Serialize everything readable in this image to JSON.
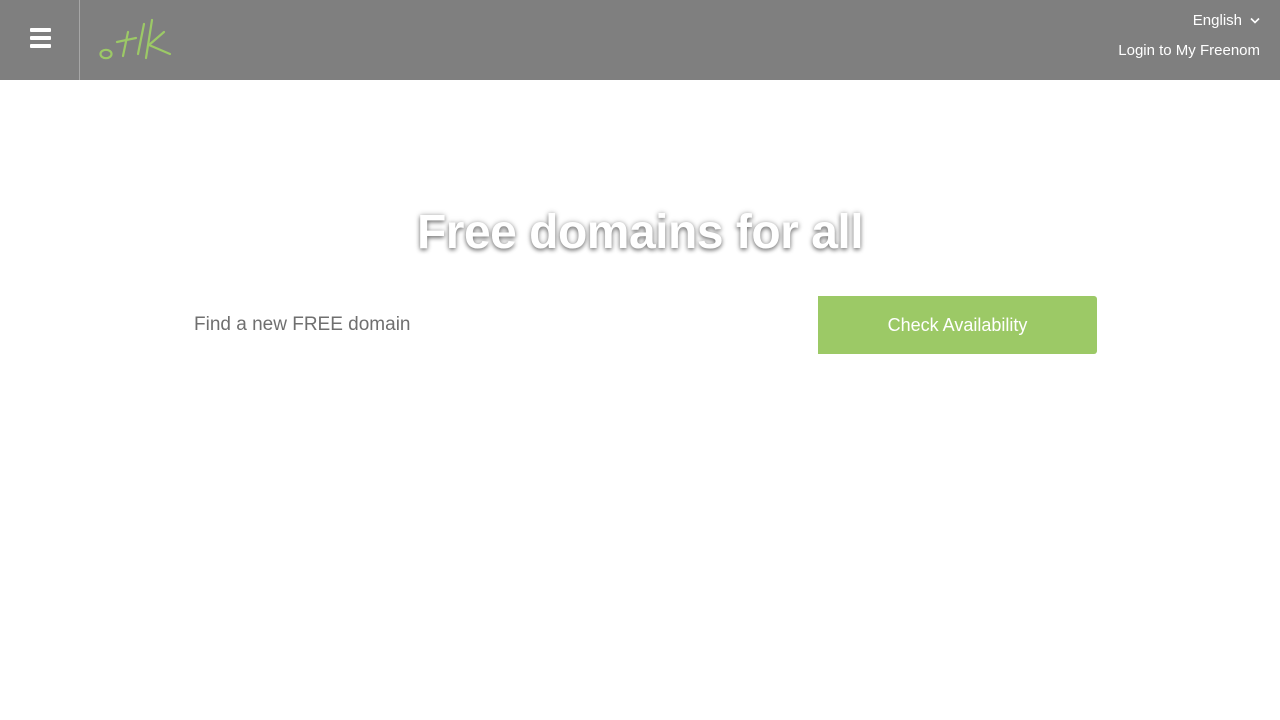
{
  "header": {
    "menu_icon": "hamburger-icon",
    "logo_text": ".tk",
    "logo_color": "#9cc966",
    "language_label": "English",
    "language_icon": "chevron-down-icon",
    "login_label": "Login to My Freenom",
    "background_color": "#7f7f7f"
  },
  "hero": {
    "title_part1": "Free domains ",
    "title_part2": "for all"
  },
  "search": {
    "placeholder": "Find a new FREE domain",
    "value": "",
    "button_label": "Check Availability",
    "button_color": "#9cc966"
  }
}
